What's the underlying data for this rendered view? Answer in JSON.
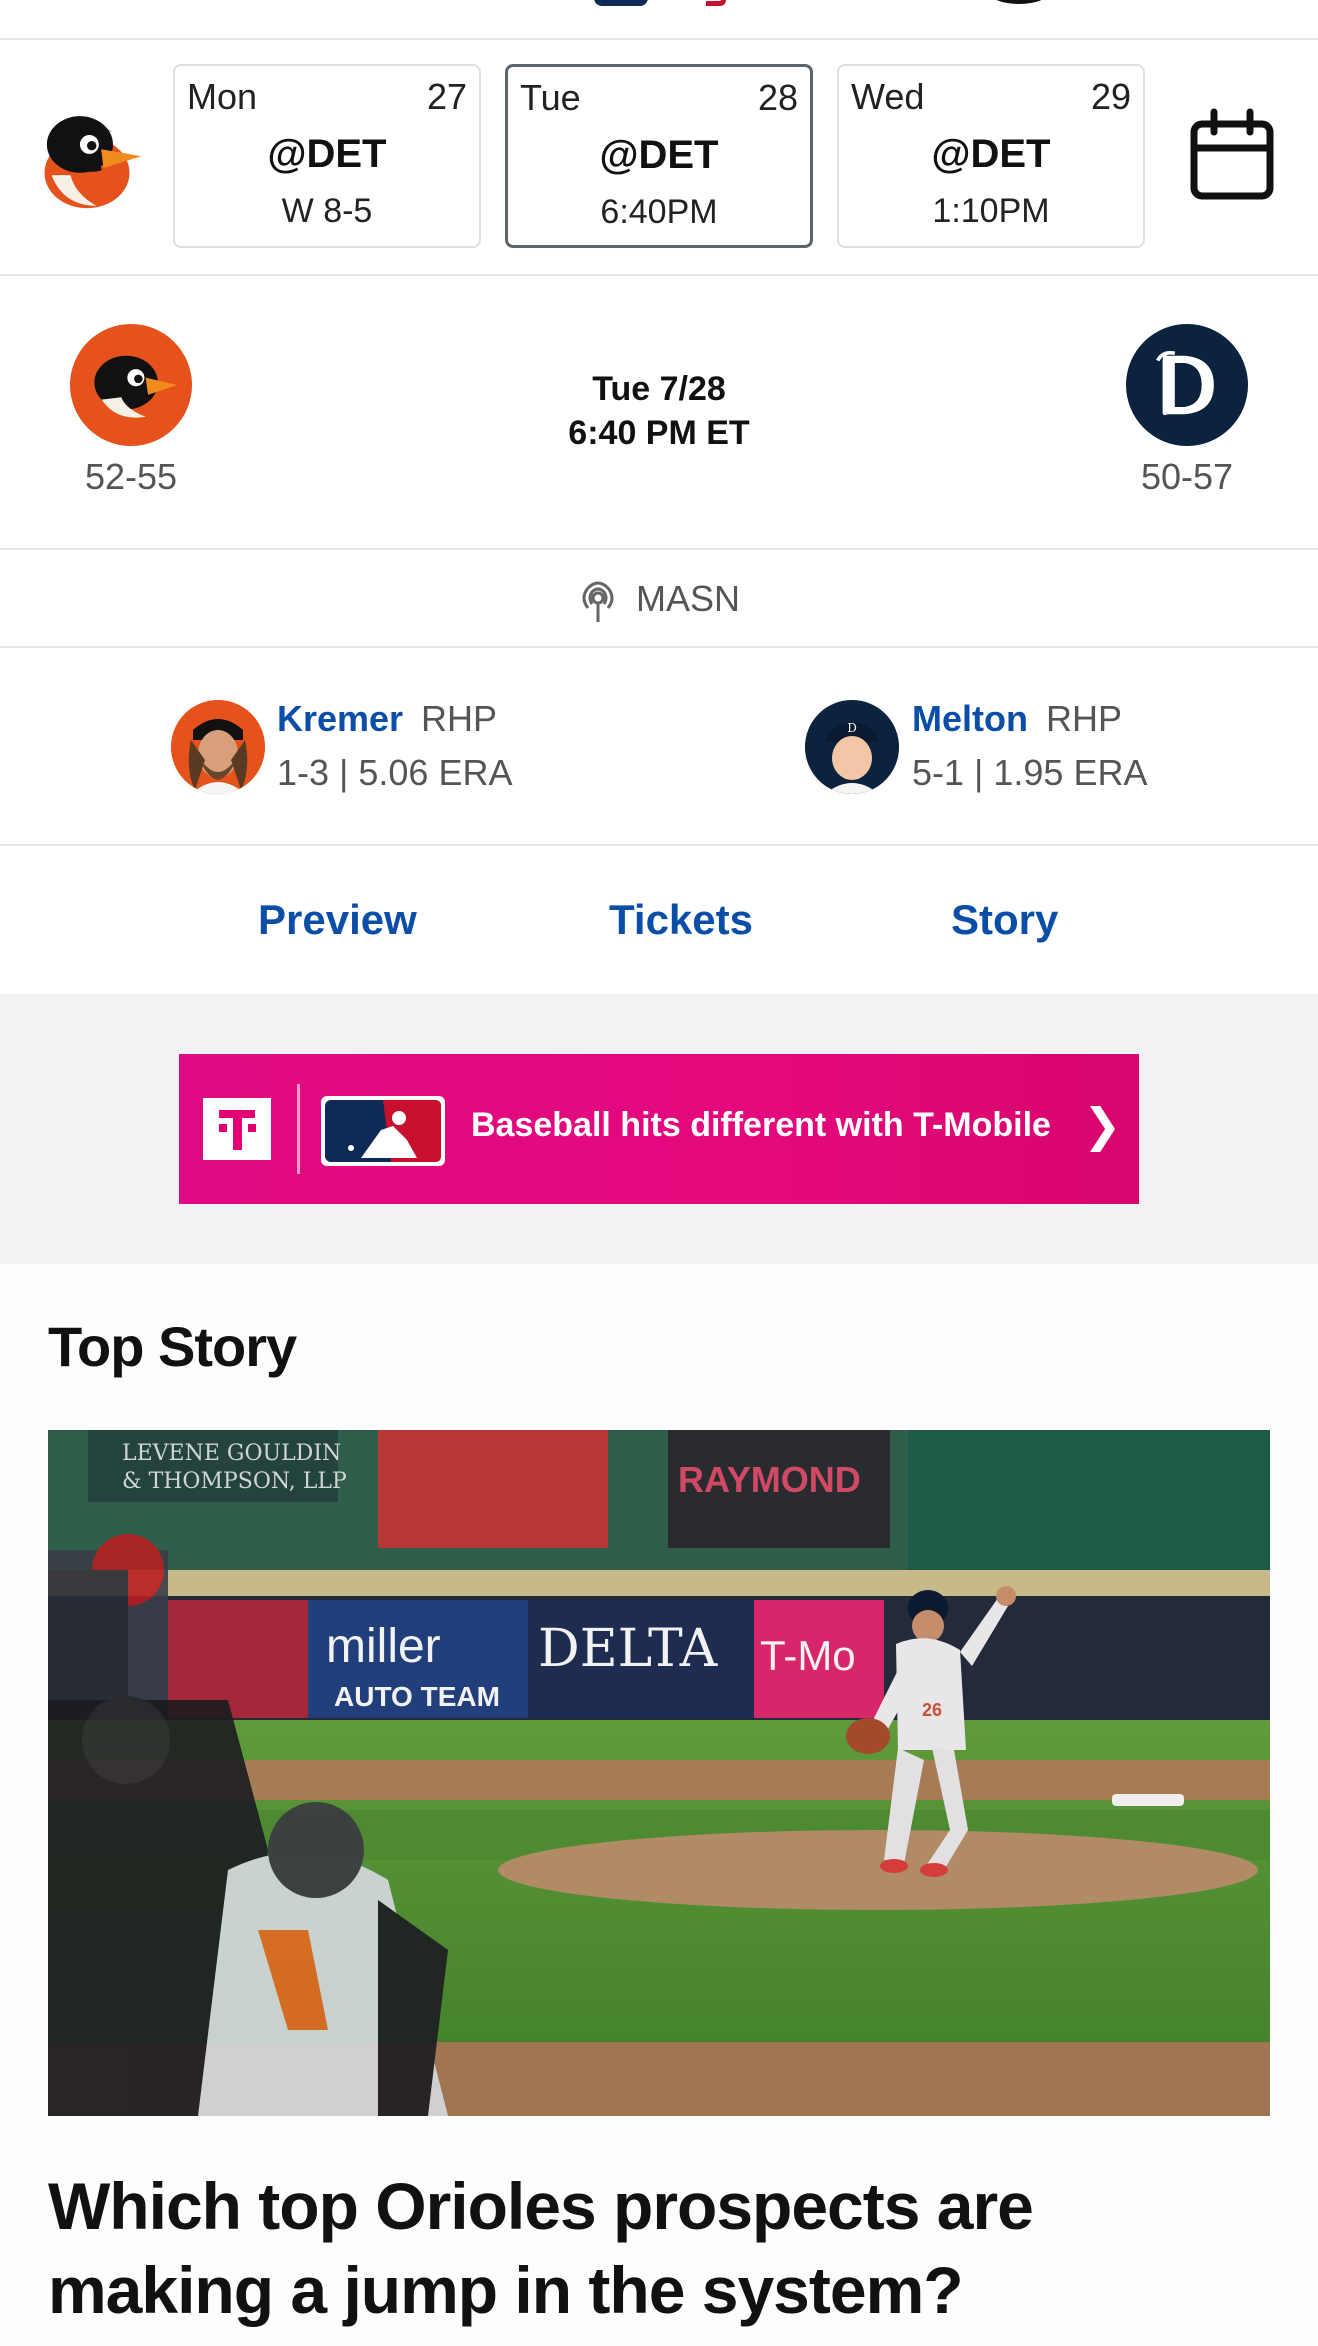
{
  "schedule": {
    "games": [
      {
        "day": "Mon",
        "date": "27",
        "opponent": "@DET",
        "result": "W 8-5",
        "selected": false
      },
      {
        "day": "Tue",
        "date": "28",
        "opponent": "@DET",
        "result": "6:40PM",
        "selected": true
      },
      {
        "day": "Wed",
        "date": "29",
        "opponent": "@DET",
        "result": "1:10PM",
        "selected": false
      }
    ]
  },
  "matchup": {
    "away_record": "52-55",
    "home_record": "50-57",
    "date": "Tue 7/28",
    "time": "6:40 PM ET"
  },
  "broadcast": {
    "label": "MASN"
  },
  "pitchers": {
    "away": {
      "name": "Kremer",
      "position": "RHP",
      "stats": "1-3 | 5.06 ERA"
    },
    "home": {
      "name": "Melton",
      "position": "RHP",
      "stats": "5-1 | 1.95 ERA"
    }
  },
  "links": {
    "preview": "Preview",
    "tickets": "Tickets",
    "story": "Story"
  },
  "ad": {
    "text": "Baseball hits different with T-Mobile",
    "chevron": "❯"
  },
  "top_story": {
    "section_title": "Top Story",
    "headline": "Which top Orioles prospects are making a jump in the system?",
    "image_signage": {
      "sign1_line1": "LEVENE GOULDIN",
      "sign1_line2": "& THOMPSON, LLP",
      "sign2": "RAYMOND",
      "sign3_line1": "miller",
      "sign3_line2": "AUTO TEAM",
      "sign4": "DELTA",
      "sign5": "T-Mo",
      "jersey_number": "26"
    }
  },
  "colors": {
    "orioles_orange": "#e5521b",
    "tigers_navy": "#0c2340",
    "link_blue": "#0b4ea8",
    "tmobile_magenta": "#e20074"
  }
}
